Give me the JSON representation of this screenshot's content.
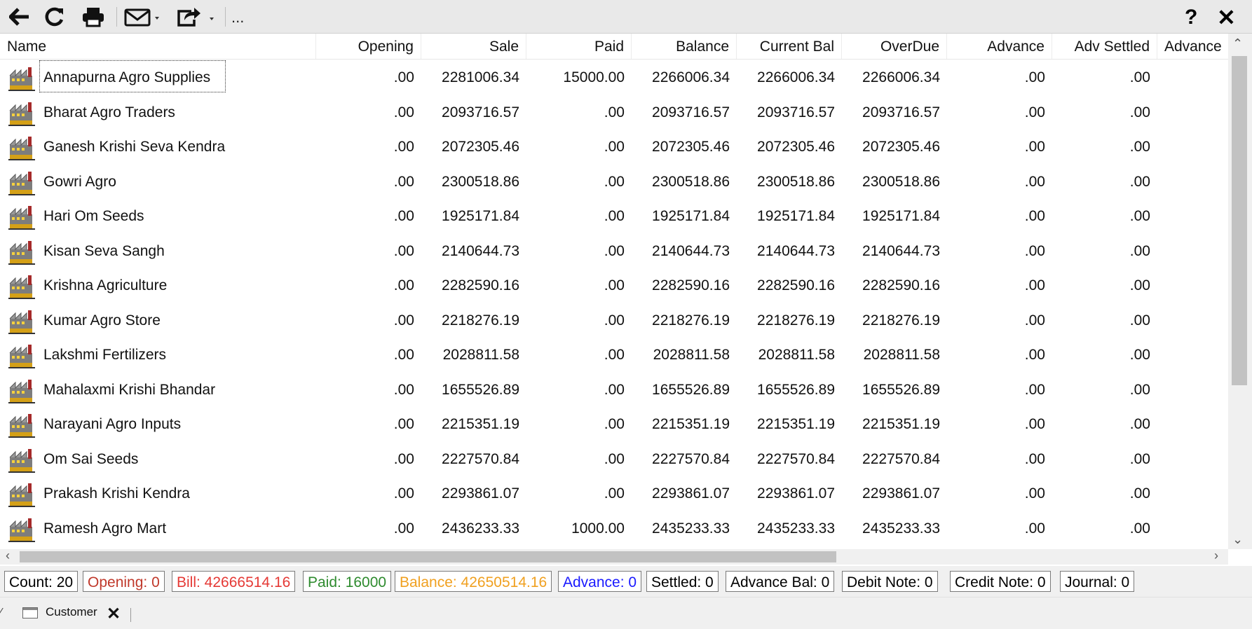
{
  "toolbar": {
    "more_label": "...",
    "help_label": "?",
    "close_label": "✕"
  },
  "columns": [
    "Name",
    "Opening",
    "Sale",
    "Paid",
    "Balance",
    "Current Bal",
    "OverDue",
    "Advance",
    "Adv Settled",
    "Advance"
  ],
  "rows": [
    {
      "name": "Annapurna Agro Supplies",
      "opening": ".00",
      "sale": "2281006.34",
      "paid": "15000.00",
      "balance": "2266006.34",
      "current_bal": "2266006.34",
      "overdue": "2266006.34",
      "advance": ".00",
      "adv_settled": ".00"
    },
    {
      "name": "Bharat Agro Traders",
      "opening": ".00",
      "sale": "2093716.57",
      "paid": ".00",
      "balance": "2093716.57",
      "current_bal": "2093716.57",
      "overdue": "2093716.57",
      "advance": ".00",
      "adv_settled": ".00"
    },
    {
      "name": "Ganesh Krishi Seva Kendra",
      "opening": ".00",
      "sale": "2072305.46",
      "paid": ".00",
      "balance": "2072305.46",
      "current_bal": "2072305.46",
      "overdue": "2072305.46",
      "advance": ".00",
      "adv_settled": ".00"
    },
    {
      "name": "Gowri Agro",
      "opening": ".00",
      "sale": "2300518.86",
      "paid": ".00",
      "balance": "2300518.86",
      "current_bal": "2300518.86",
      "overdue": "2300518.86",
      "advance": ".00",
      "adv_settled": ".00"
    },
    {
      "name": "Hari Om Seeds",
      "opening": ".00",
      "sale": "1925171.84",
      "paid": ".00",
      "balance": "1925171.84",
      "current_bal": "1925171.84",
      "overdue": "1925171.84",
      "advance": ".00",
      "adv_settled": ".00"
    },
    {
      "name": "Kisan Seva Sangh",
      "opening": ".00",
      "sale": "2140644.73",
      "paid": ".00",
      "balance": "2140644.73",
      "current_bal": "2140644.73",
      "overdue": "2140644.73",
      "advance": ".00",
      "adv_settled": ".00"
    },
    {
      "name": "Krishna Agriculture",
      "opening": ".00",
      "sale": "2282590.16",
      "paid": ".00",
      "balance": "2282590.16",
      "current_bal": "2282590.16",
      "overdue": "2282590.16",
      "advance": ".00",
      "adv_settled": ".00"
    },
    {
      "name": "Kumar Agro Store",
      "opening": ".00",
      "sale": "2218276.19",
      "paid": ".00",
      "balance": "2218276.19",
      "current_bal": "2218276.19",
      "overdue": "2218276.19",
      "advance": ".00",
      "adv_settled": ".00"
    },
    {
      "name": "Lakshmi Fertilizers",
      "opening": ".00",
      "sale": "2028811.58",
      "paid": ".00",
      "balance": "2028811.58",
      "current_bal": "2028811.58",
      "overdue": "2028811.58",
      "advance": ".00",
      "adv_settled": ".00"
    },
    {
      "name": "Mahalaxmi Krishi Bhandar",
      "opening": ".00",
      "sale": "1655526.89",
      "paid": ".00",
      "balance": "1655526.89",
      "current_bal": "1655526.89",
      "overdue": "1655526.89",
      "advance": ".00",
      "adv_settled": ".00"
    },
    {
      "name": "Narayani Agro Inputs",
      "opening": ".00",
      "sale": "2215351.19",
      "paid": ".00",
      "balance": "2215351.19",
      "current_bal": "2215351.19",
      "overdue": "2215351.19",
      "advance": ".00",
      "adv_settled": ".00"
    },
    {
      "name": "Om Sai Seeds",
      "opening": ".00",
      "sale": "2227570.84",
      "paid": ".00",
      "balance": "2227570.84",
      "current_bal": "2227570.84",
      "overdue": "2227570.84",
      "advance": ".00",
      "adv_settled": ".00"
    },
    {
      "name": "Prakash Krishi Kendra",
      "opening": ".00",
      "sale": "2293861.07",
      "paid": ".00",
      "balance": "2293861.07",
      "current_bal": "2293861.07",
      "overdue": "2293861.07",
      "advance": ".00",
      "adv_settled": ".00"
    },
    {
      "name": "Ramesh Agro Mart",
      "opening": ".00",
      "sale": "2436233.33",
      "paid": "1000.00",
      "balance": "2435233.33",
      "current_bal": "2435233.33",
      "overdue": "2435233.33",
      "advance": ".00",
      "adv_settled": ".00"
    }
  ],
  "status": {
    "count": "Count: 20",
    "opening": "Opening: 0",
    "bill": "Bill: 42666514.16",
    "paid": "Paid: 16000",
    "balance": "Balance: 42650514.16",
    "advance": "Advance: 0",
    "settled": "Settled: 0",
    "advance_bal": "Advance Bal: 0",
    "debit_note": "Debit Note: 0",
    "credit_note": "Credit Note: 0",
    "journal": "Journal: 0"
  },
  "status_colors": {
    "opening": "#c0392b",
    "bill": "#e53935",
    "paid": "#2e8b2e",
    "balance": "#f0a020",
    "advance": "#1a1aff"
  },
  "tabs": [
    {
      "label": "Customer",
      "icon": "window-icon"
    }
  ],
  "icons": {
    "back": "arrow-left-icon",
    "refresh": "refresh-icon",
    "print": "printer-icon",
    "mail": "envelope-icon",
    "share": "share-icon",
    "row": "factory-icon"
  }
}
